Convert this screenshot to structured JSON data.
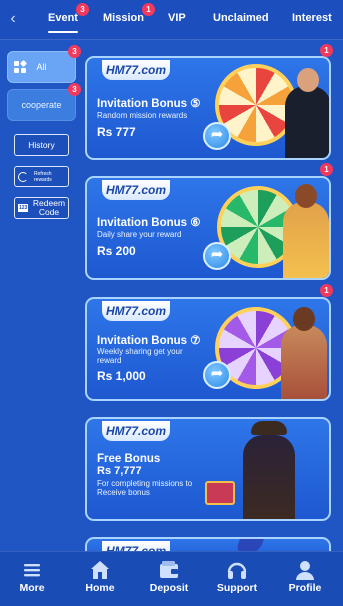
{
  "tabs": [
    {
      "label": "Event",
      "badge": "3",
      "active": true
    },
    {
      "label": "Mission",
      "badge": "1"
    },
    {
      "label": "VIP"
    },
    {
      "label": "Unclaimed"
    },
    {
      "label": "Interest"
    }
  ],
  "sidebar": {
    "all_label": "All",
    "all_badge": "3",
    "cooperate_label": "cooperate",
    "cooperate_badge": "3",
    "history_label": "History",
    "refresh_label": "Refresh rewards",
    "redeem_label": "Redeem Code"
  },
  "brand": {
    "logo_text": "HM77.com"
  },
  "cards": [
    {
      "title": "Invitation Bonus ⑤",
      "subtitle": "Random mission rewards",
      "amount": "Rs 777",
      "badge": "1"
    },
    {
      "title": "Invitation Bonus ⑥",
      "subtitle": "Daily share your reward",
      "amount": "Rs 200",
      "badge": "1"
    },
    {
      "title": "Invitation Bonus ⑦",
      "subtitle": "Weekly sharing get your reward",
      "amount": "Rs 1,000",
      "badge": "1"
    },
    {
      "title": "Free Bonus",
      "amount_line": "Rs 7,777",
      "subtitle": "For completing missions to Receive bonus"
    }
  ],
  "bottom_nav": [
    {
      "label": "More",
      "icon": "menu-icon"
    },
    {
      "label": "Home",
      "icon": "home-icon"
    },
    {
      "label": "Deposit",
      "icon": "wallet-icon"
    },
    {
      "label": "Support",
      "icon": "headset-icon"
    },
    {
      "label": "Profile",
      "icon": "user-icon"
    }
  ],
  "colors": {
    "background": "#1f56c4",
    "badge": "#f2395d",
    "card_border": "#a9d4ff",
    "wheel_gold": "#ffd15a"
  }
}
